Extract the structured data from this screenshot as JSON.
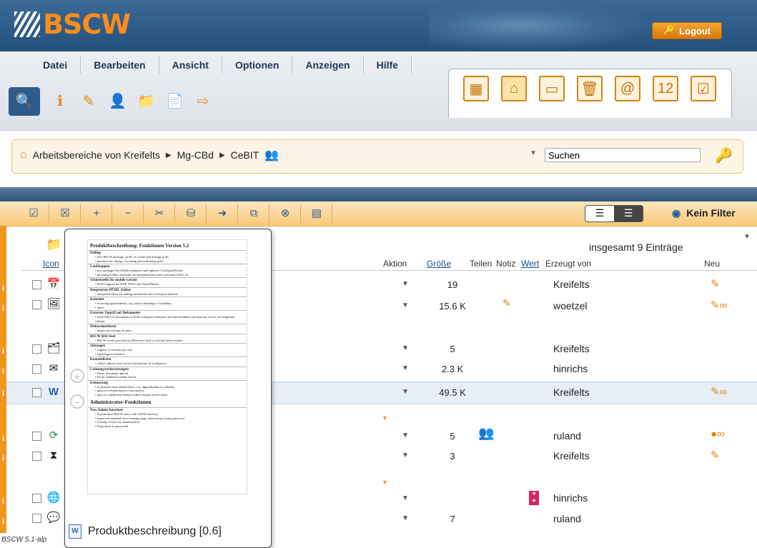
{
  "header": {
    "logo": "BSCW",
    "logout_label": "Logout"
  },
  "menu": [
    "Datei",
    "Bearbeiten",
    "Ansicht",
    "Optionen",
    "Anzeigen",
    "Hilfe"
  ],
  "breadcrumb": {
    "items": [
      "Arbeitsbereiche von Kreifelts",
      "Mg-CBd",
      "CeBIT"
    ]
  },
  "search": {
    "value": "Suchen"
  },
  "filter": {
    "label": "Kein Filter"
  },
  "list": {
    "total": "insgesamt 9 Einträge",
    "columns": {
      "icon": "Icon",
      "aktion": "Aktion",
      "groesse": "Größe",
      "teilen": "Teilen",
      "notiz": "Notiz",
      "wert": "Wert",
      "erzeugt": "Erzeugt von",
      "neu": "Neu"
    },
    "rows": [
      {
        "size": "19",
        "user": "Kreifelts",
        "icon": "calendar-icon"
      },
      {
        "size": "15.6 K",
        "user": "woetzel",
        "icon": "image-icon"
      },
      {
        "size": "5",
        "user": "Kreifelts",
        "icon": "contacts-icon"
      },
      {
        "size": "2.3 K",
        "user": "hinrichs",
        "icon": "note-icon"
      },
      {
        "size": "49.5 K",
        "user": "Kreifelts",
        "icon": "word-doc-icon"
      },
      {
        "size": "5",
        "user": "ruland",
        "icon": "sync-icon"
      },
      {
        "size": "3",
        "user": "Kreifelts",
        "icon": "hourglass-icon"
      },
      {
        "size": "",
        "user": "hinrichs",
        "icon": "link-icon"
      },
      {
        "size": "7",
        "user": "ruland",
        "icon": "chat-icon"
      }
    ]
  },
  "preview": {
    "label": "Produktbeschreibung [0.6]",
    "doc_title": "Produktbeschreibung: Funktionen Version 5.2",
    "sections": [
      {
        "title": "Polling",
        "lines": [
          "new BSCW package „polls“ to create and manage polls",
          "interface for editing, executing and evaluating polls"
        ]
      },
      {
        "title": "Laufmappen",
        "lines": [
          "new package FlowFolder enhances and replaces CirculationFolder",
          "incoming folders and tasks are integrated into user's personal Task List"
        ]
      },
      {
        "title": "Schnittstelle für mobile Geräte",
        "lines": [
          "WAP Support for WAP, PDAs and SmartPhones"
        ]
      },
      {
        "title": "Integrierter HTML-Editor",
        "lines": [
          "integrated editor for editing documents and workspace banners"
        ]
      },
      {
        "title": "Kalender",
        "lines": [
          "recurring appointments, e.g. project meetings or birthdays",
          "alerts"
        ]
      },
      {
        "title": "Externer Zugriff auf Dokumente",
        "lines": [
          "send URLs of documents to both workspace members and non-members (anonymous access via temporary tokens)"
        ]
      },
      {
        "title": "Diskussionsforen",
        "lines": [
          "improved viewing of notes"
        ]
      },
      {
        "title": "BSCW RSS feed",
        "lines": [
          "BSCW events provided as RSS news feed to external news readers"
        ]
      },
      {
        "title": "Sitzungen",
        "lines": [
          "support of sessions per user",
          "login/logout function"
        ]
      },
      {
        "title": "Kontaktlisten",
        "lines": [
          "collect address and contact information in workspaces"
        ]
      },
      {
        "title": "Leistungsverbesserungen",
        "lines": [
          "Faster document upload",
          "Faster standard content search"
        ]
      },
      {
        "title": "Erinnerung",
        "lines": [
          "to generate time related alerts, e.g. appointments in calendar",
          "upon for resubmission of documents",
          "upon for additional features which require active alerts"
        ]
      }
    ],
    "section2_title": "Administrator-Funktionen",
    "section2": {
      "title": "New Admin functions",
      "lines": [
        "Synchronize BSCW users with LDAP directory",
        "improved standard error message page when using wrong password",
        "locking of users by administrator",
        "Expiration of passwords"
      ]
    }
  },
  "footer": {
    "version": "BSCW 5.1-alp"
  }
}
